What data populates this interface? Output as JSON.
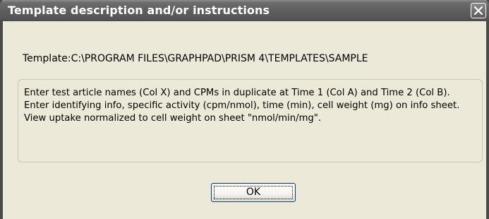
{
  "window": {
    "title": "Template description and/or instructions",
    "close_icon": "close-icon"
  },
  "template_path": "Template:C:\\PROGRAM FILES\\GRAPHPAD\\PRISM 4\\TEMPLATES\\SAMPLE",
  "description": "Enter test article names (Col X) and CPMs in duplicate at Time 1 (Col A) and Time 2 (Col B). Enter identifying info, specific activity (cpm/nmol), time (min), cell weight (mg) on info sheet. View uptake normalized to cell weight on sheet \"nmol/min/mg\".",
  "buttons": {
    "ok_label": "OK"
  },
  "colors": {
    "titlebar": "#5e5e5e",
    "dialog_background": "#ece9d8",
    "button_border": "#003c74"
  }
}
